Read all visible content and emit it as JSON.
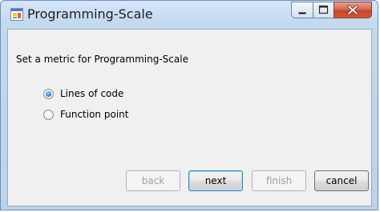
{
  "window": {
    "title": "Programming-Scale",
    "icon": "app-window-icon",
    "controls": [
      "minimize-icon",
      "maximize-icon",
      "close-icon"
    ]
  },
  "content": {
    "prompt": "Set a metric for Programming-Scale",
    "options": [
      {
        "label": "Lines of code",
        "selected": true
      },
      {
        "label": "Function point",
        "selected": false
      }
    ]
  },
  "buttons": {
    "back": {
      "label": "back",
      "enabled": false
    },
    "next": {
      "label": "next",
      "enabled": true
    },
    "finish": {
      "label": "finish",
      "enabled": false
    },
    "cancel": {
      "label": "cancel",
      "enabled": true
    }
  },
  "colors": {
    "title_bar": "#c3d9f0",
    "close_button": "#c6452c",
    "radio_selected": "#2a7fd4"
  }
}
